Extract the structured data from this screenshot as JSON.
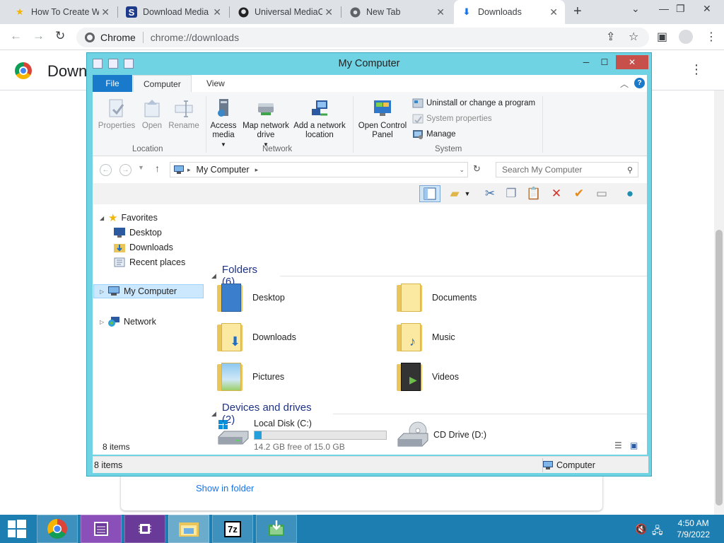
{
  "browser": {
    "tabs": [
      {
        "title": "How To Create W",
        "favicon": "star-icon"
      },
      {
        "title": "Download Media",
        "favicon": "s-icon"
      },
      {
        "title": "Universal MediaC",
        "favicon": "github-icon"
      },
      {
        "title": "New Tab",
        "favicon": "chrome-icon"
      },
      {
        "title": "Downloads",
        "favicon": "download-icon"
      }
    ],
    "address": {
      "site": "Chrome",
      "url": "chrome://downloads"
    }
  },
  "downloads_page": {
    "title": "Down",
    "show_in_folder": "Show in folder"
  },
  "explorer": {
    "title": "My Computer",
    "ribbon_tabs": [
      "File",
      "Computer",
      "View"
    ],
    "ribbon": {
      "location": {
        "label": "Location",
        "buttons": [
          "Properties",
          "Open",
          "Rename"
        ]
      },
      "network": {
        "label": "Network",
        "access_media": "Access media",
        "map_drive": "Map network drive",
        "add_location": "Add a network location"
      },
      "system": {
        "label": "System",
        "open_control_panel": "Open Control Panel",
        "uninstall": "Uninstall or change a program",
        "system_properties": "System properties",
        "manage": "Manage"
      }
    },
    "address_path": "My Computer",
    "search_placeholder": "Search My Computer",
    "nav": {
      "favorites": "Favorites",
      "desktop": "Desktop",
      "downloads": "Downloads",
      "recent": "Recent places",
      "my_computer": "My Computer",
      "network": "Network"
    },
    "folders_header": "Folders (6)",
    "folders": [
      "Desktop",
      "Documents",
      "Downloads",
      "Music",
      "Pictures",
      "Videos"
    ],
    "devices_header": "Devices and drives (2)",
    "drives": {
      "c_name": "Local Disk (C:)",
      "c_free": "14.2 GB free of 15.0 GB",
      "c_used_fraction": 0.053,
      "d_name": "CD Drive (D:)"
    },
    "status_items": "8 items",
    "statusbar_items": "8 items",
    "statusbar_location": "Computer"
  },
  "taskbar": {
    "time": "4:50 AM",
    "date": "7/9/2022"
  },
  "colors": {
    "accent": "#1979ca",
    "window_border": "#6fd3e3",
    "taskbar": "#1c7eb1"
  }
}
